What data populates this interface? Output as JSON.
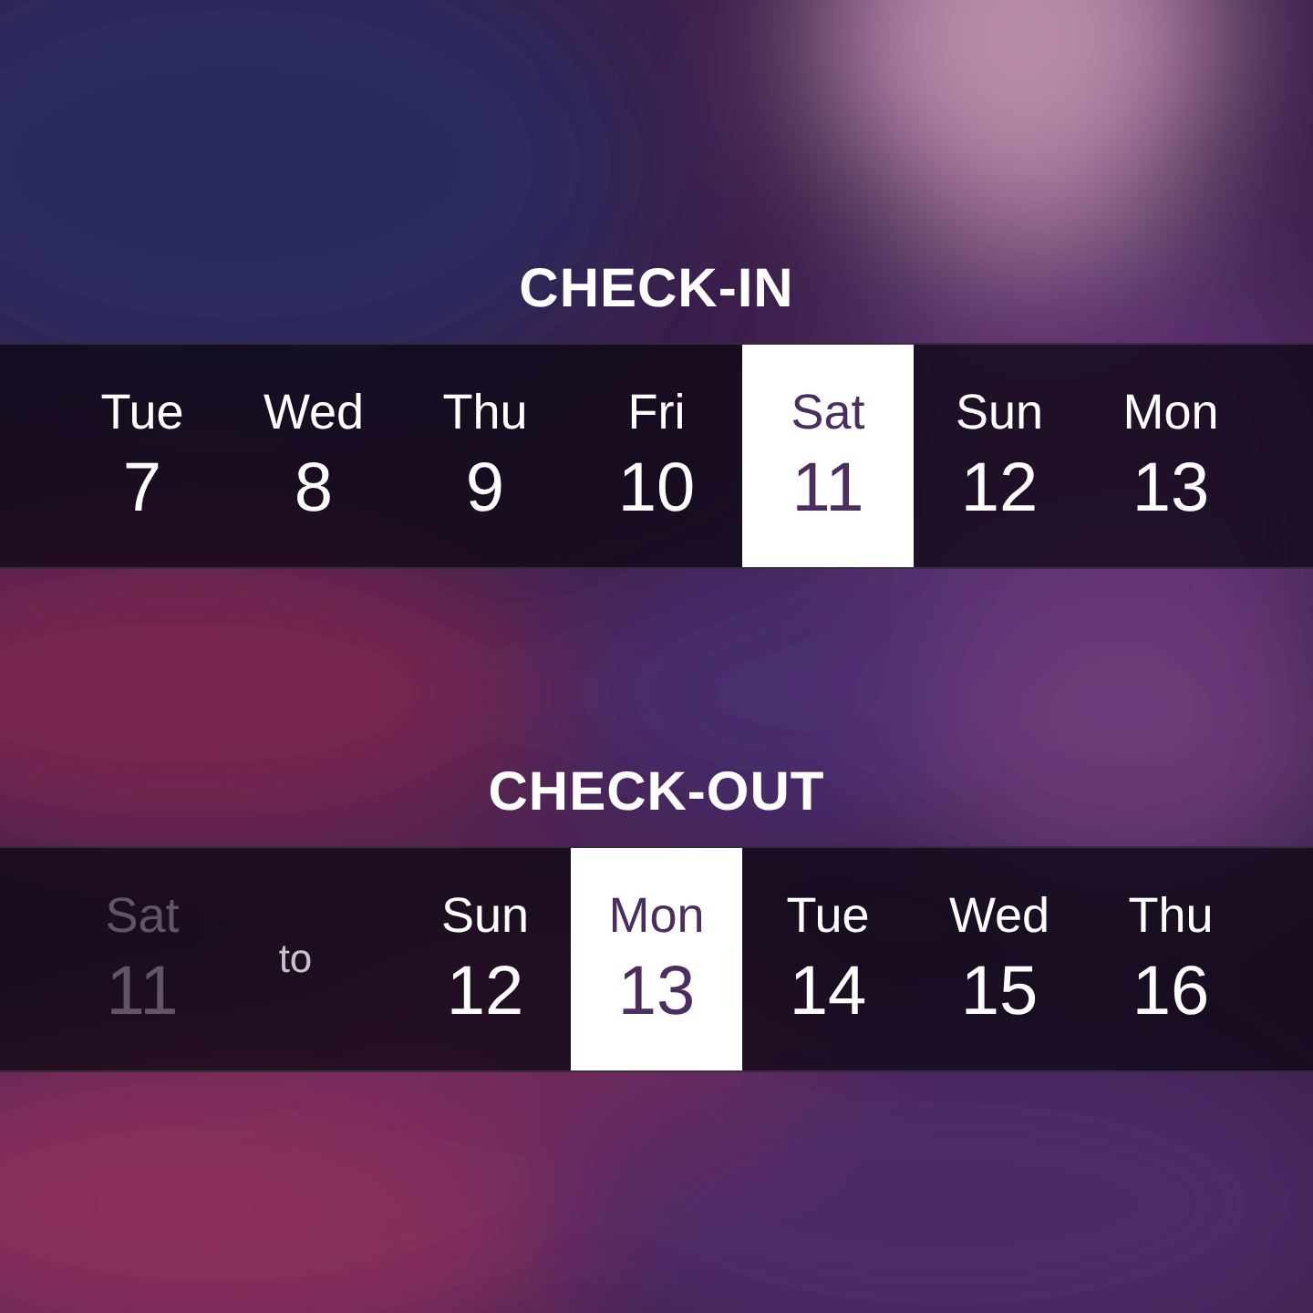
{
  "check_in": {
    "title": "CHECK-IN",
    "days": [
      {
        "weekday": "Tue",
        "day": "7",
        "selected": false
      },
      {
        "weekday": "Wed",
        "day": "8",
        "selected": false
      },
      {
        "weekday": "Thu",
        "day": "9",
        "selected": false
      },
      {
        "weekday": "Fri",
        "day": "10",
        "selected": false
      },
      {
        "weekday": "Sat",
        "day": "11",
        "selected": true
      },
      {
        "weekday": "Sun",
        "day": "12",
        "selected": false
      },
      {
        "weekday": "Mon",
        "day": "13",
        "selected": false
      }
    ]
  },
  "check_out": {
    "title": "CHECK-OUT",
    "from": {
      "weekday": "Sat",
      "day": "11",
      "disabled": true
    },
    "separator": "to",
    "days": [
      {
        "weekday": "Sun",
        "day": "12",
        "selected": false
      },
      {
        "weekday": "Mon",
        "day": "13",
        "selected": true
      },
      {
        "weekday": "Tue",
        "day": "14",
        "selected": false
      },
      {
        "weekday": "Wed",
        "day": "15",
        "selected": false
      },
      {
        "weekday": "Thu",
        "day": "16",
        "selected": false
      }
    ]
  }
}
